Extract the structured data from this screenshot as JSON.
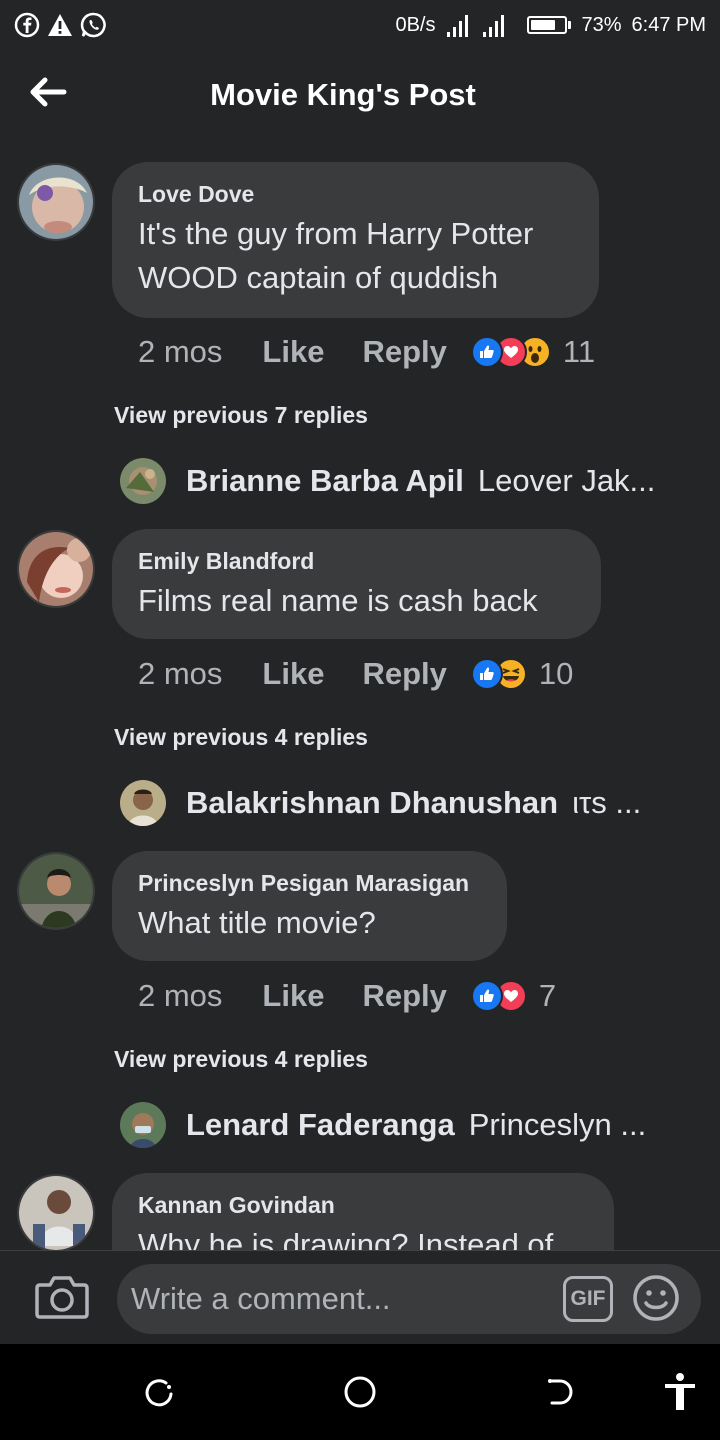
{
  "status_bar": {
    "net_speed": "0B/s",
    "battery_percent": "73%",
    "battery_level": 0.73,
    "time": "6:47 PM",
    "icons": [
      "facebook-icon",
      "warning-icon",
      "whatsapp-icon",
      "signal-icon",
      "battery-icon"
    ]
  },
  "header": {
    "title": "Movie King's Post",
    "back_icon": "arrow-left-icon"
  },
  "comments": [
    {
      "author": "Love Dove",
      "text_lines": [
        "It's the guy from Harry Potter",
        "WOOD captain of quddish"
      ],
      "time": "2 mos",
      "like_label": "Like",
      "reply_label": "Reply",
      "reactions": [
        "like",
        "love",
        "wow"
      ],
      "reaction_count": "11",
      "view_previous": "View previous 7 replies",
      "reply_preview": {
        "author": "Brianne Barba Apil",
        "snippet": "Leover Jak..."
      }
    },
    {
      "author": "Emily Blandford",
      "text_lines": [
        "Films real name is cash back"
      ],
      "time": "2 mos",
      "like_label": "Like",
      "reply_label": "Reply",
      "reactions": [
        "like",
        "haha"
      ],
      "reaction_count": "10",
      "view_previous": "View previous 4 replies",
      "reply_preview": {
        "author": "Balakrishnan Dhanushan",
        "snippet": "ιτѕ ..."
      }
    },
    {
      "author": "Princeslyn Pesigan Marasigan",
      "text_lines": [
        "What title movie?"
      ],
      "time": "2 mos",
      "like_label": "Like",
      "reply_label": "Reply",
      "reactions": [
        "like",
        "love"
      ],
      "reaction_count": "7",
      "view_previous": "View previous 4 replies",
      "reply_preview": {
        "author": "Lenard Faderanga",
        "snippet": "Princeslyn ..."
      }
    },
    {
      "author": "Kannan Govindan",
      "text_lines": [
        "Why he is drawing? Instead of"
      ]
    }
  ],
  "composer": {
    "placeholder": "Write a comment...",
    "gif_label": "GIF",
    "camera_icon": "camera-icon",
    "emoji_icon": "emoji-icon"
  },
  "nav_bar": {
    "icons": [
      "recents-icon",
      "home-icon",
      "back-icon",
      "accessibility-icon"
    ]
  }
}
